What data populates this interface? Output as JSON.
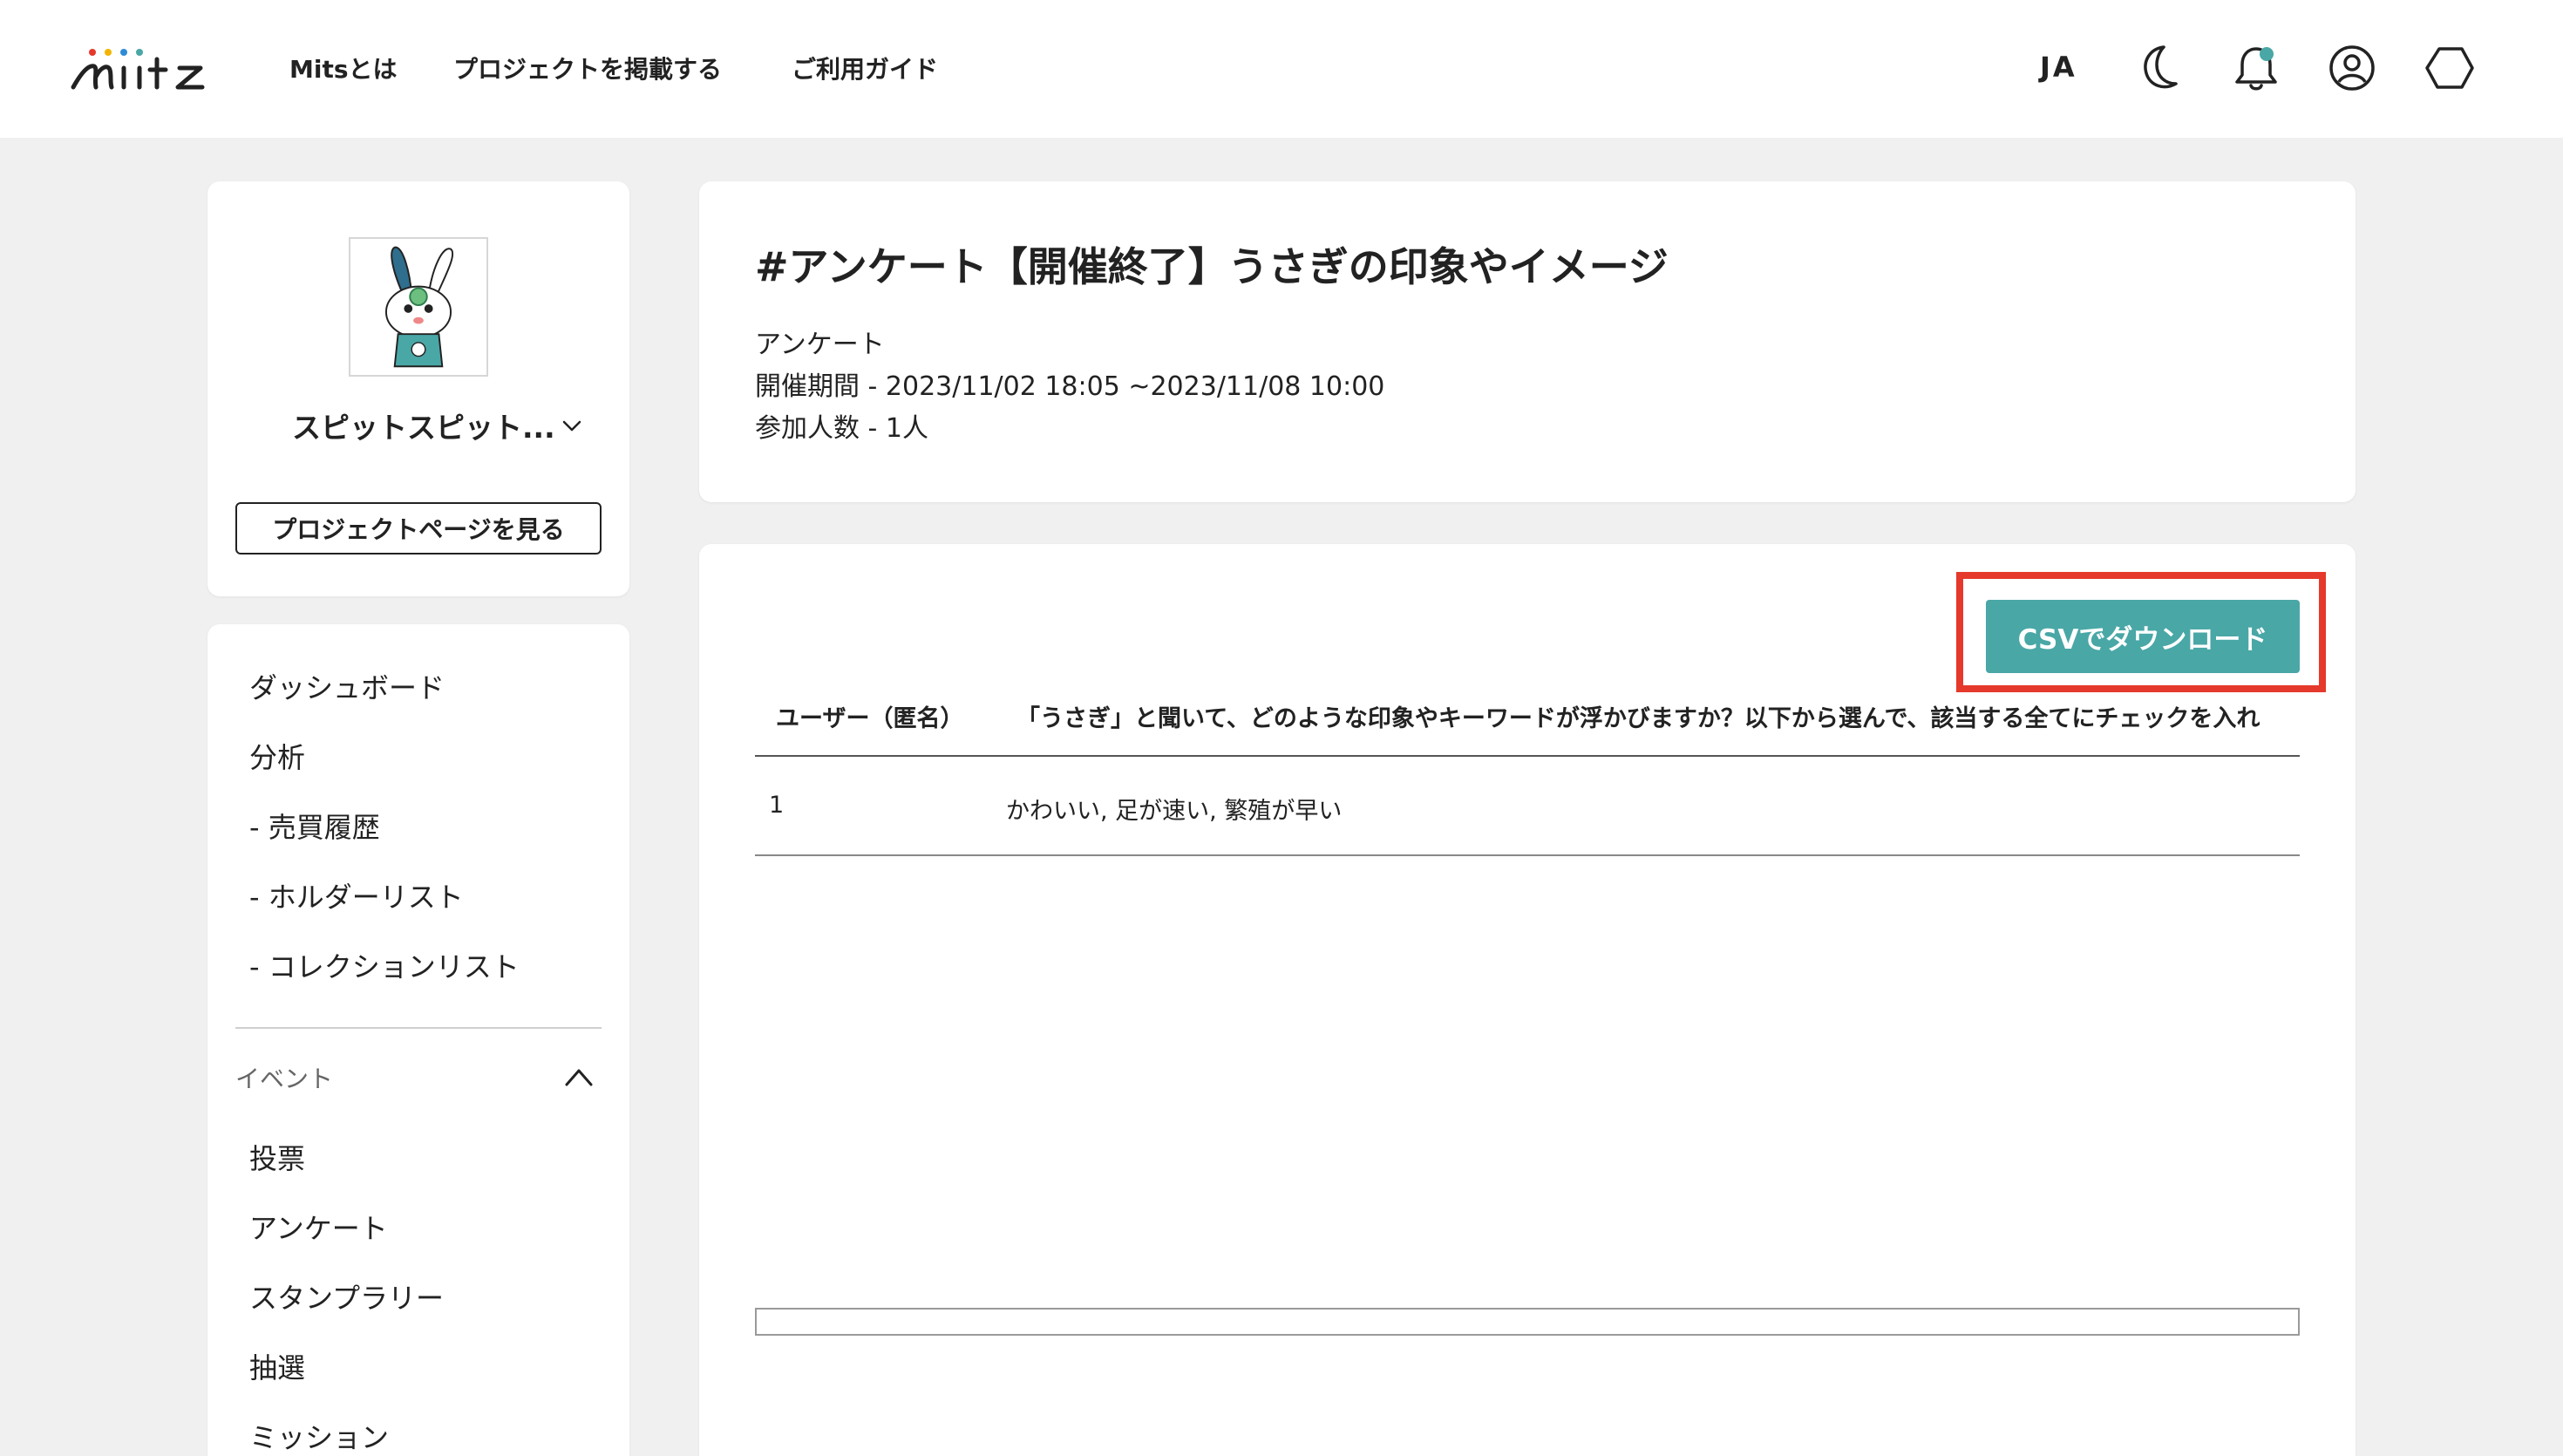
{
  "header": {
    "nav": [
      "Mitsとは",
      "プロジェクトを掲載する",
      "ご利用ガイド"
    ],
    "lang": "JA",
    "accent_color": "#49a7a6"
  },
  "project": {
    "name": "スピットスピット...",
    "view_button": "プロジェクトページを見る"
  },
  "sidebar": {
    "items": [
      "ダッシュボード",
      "分析",
      "- 売買履歴",
      "- ホルダーリスト",
      "- コレクションリスト"
    ],
    "event_section": {
      "label": "イベント",
      "items": [
        "投票",
        "アンケート",
        "スタンプラリー",
        "抽選",
        "ミッション"
      ]
    }
  },
  "survey": {
    "title": "#アンケート【開催終了】うさぎの印象やイメージ",
    "type": "アンケート",
    "period": "開催期間 - 2023/11/02 18:05 ~2023/11/08 10:00",
    "participants": "参加人数 - 1人"
  },
  "results": {
    "csv_button": "CSVでダウンロード",
    "columns": [
      "ユーザー（匿名）",
      "「うさぎ」と聞いて、どのような印象やキーワードが浮かびますか？以下から選んで、該当する全てにチェックを入れ"
    ],
    "rows": [
      [
        "1",
        "かわいい, 足が速い, 繁殖が早い"
      ]
    ],
    "highlight_color": "#e5392c"
  }
}
